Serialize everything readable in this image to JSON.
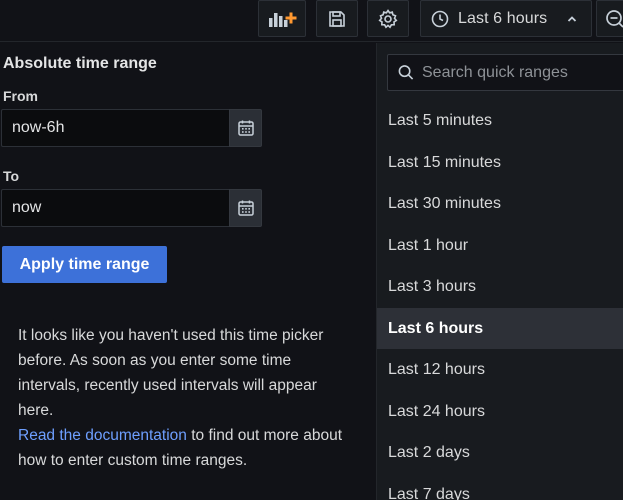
{
  "toolbar": {
    "time_picker_label": "Last 6 hours",
    "add_panel_accent": "#ff9830"
  },
  "absolute": {
    "title": "Absolute time range",
    "from_label": "From",
    "from_value": "now-6h",
    "to_label": "To",
    "to_value": "now",
    "apply_label": "Apply time range"
  },
  "empty_state": {
    "text": "It looks like you haven't used this time picker before. As soon as you enter some time intervals, recently used intervals will appear here.",
    "link_text": "Read the documentation",
    "after_link": " to find out more about how to enter custom time ranges."
  },
  "quick": {
    "search_placeholder": "Search quick ranges",
    "items": [
      {
        "label": "Last 5 minutes",
        "active": false
      },
      {
        "label": "Last 15 minutes",
        "active": false
      },
      {
        "label": "Last 30 minutes",
        "active": false
      },
      {
        "label": "Last 1 hour",
        "active": false
      },
      {
        "label": "Last 3 hours",
        "active": false
      },
      {
        "label": "Last 6 hours",
        "active": true
      },
      {
        "label": "Last 12 hours",
        "active": false
      },
      {
        "label": "Last 24 hours",
        "active": false
      },
      {
        "label": "Last 2 days",
        "active": false
      },
      {
        "label": "Last 7 days",
        "active": false
      }
    ]
  },
  "icons": {
    "add_panel": "add-panel-icon",
    "save": "save-icon",
    "settings": "gear-icon",
    "clock": "clock-icon",
    "chevron": "chevron-up-icon",
    "zoom_out": "zoom-out-icon",
    "calendar": "calendar-icon",
    "search": "search-icon"
  },
  "colors": {
    "primary": "#3d71d9",
    "link": "#6e9fff",
    "background": "#111217",
    "panel": "#181b1f",
    "active_row": "#2d3037"
  }
}
